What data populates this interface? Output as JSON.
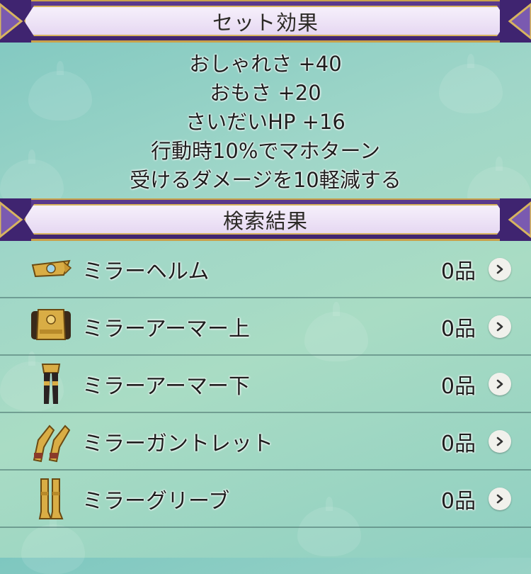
{
  "set_effect_header": {
    "title": "セット効果"
  },
  "set_effects": [
    "おしゃれさ +40",
    "おもさ +20",
    "さいだいHP +16",
    "行動時10%でマホターン",
    "受けるダメージを10軽減する"
  ],
  "search_results_header": {
    "title": "検索結果"
  },
  "results": [
    {
      "name": "ミラーヘルム",
      "count": "0品",
      "icon": "helmet-icon"
    },
    {
      "name": "ミラーアーマー上",
      "count": "0品",
      "icon": "armor-top-icon"
    },
    {
      "name": "ミラーアーマー下",
      "count": "0品",
      "icon": "armor-bottom-icon"
    },
    {
      "name": "ミラーガントレット",
      "count": "0品",
      "icon": "gauntlet-icon"
    },
    {
      "name": "ミラーグリーブ",
      "count": "0品",
      "icon": "greaves-icon"
    }
  ],
  "colors": {
    "header_band": "#4a2d7e",
    "header_gold": "#c9a24a",
    "plate": "#eee3f6",
    "background": "#9fd6c8"
  }
}
